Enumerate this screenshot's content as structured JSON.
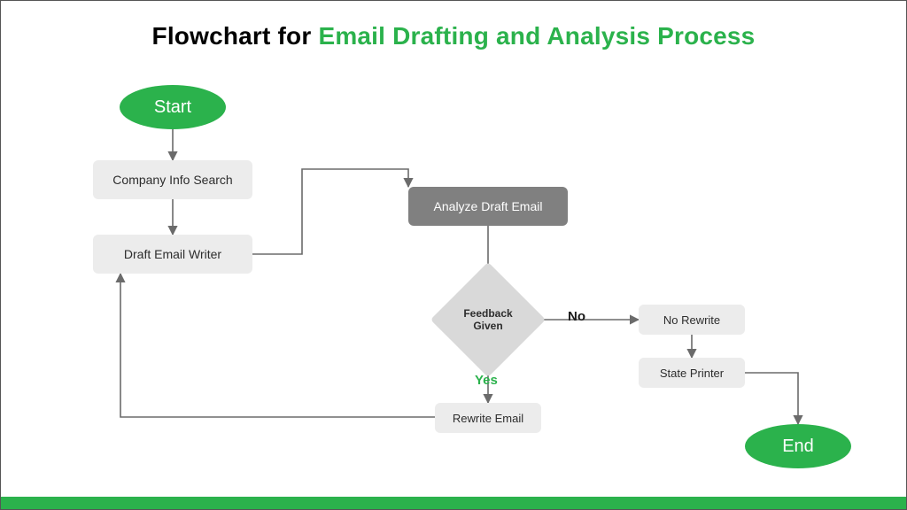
{
  "title_prefix": "Flowchart for ",
  "title_accent": "Email Drafting and Analysis Process",
  "nodes": {
    "start": "Start",
    "company_search": "Company Info Search",
    "draft_writer": "Draft Email Writer",
    "analyze": "Analyze Draft Email",
    "decision": "Feedback Given",
    "no_rewrite": "No Rewrite",
    "state_printer": "State Printer",
    "rewrite": "Rewrite Email",
    "end": "End"
  },
  "edges": {
    "yes": "Yes",
    "no": "No"
  },
  "colors": {
    "accent": "#2bb24c",
    "node_bg": "#ececec",
    "node_dark": "#808080",
    "diamond": "#d9d9d9",
    "arrow": "#6b6b6b"
  }
}
